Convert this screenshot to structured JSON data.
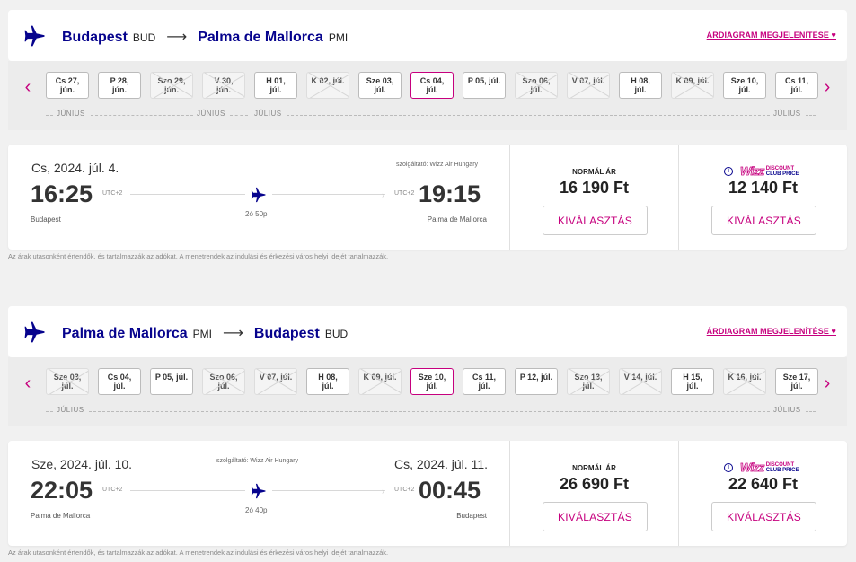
{
  "outbound": {
    "route": {
      "from_city": "Budapest",
      "from_code": "BUD",
      "to_city": "Palma de Mallorca",
      "to_code": "PMI",
      "diagram_link": "ÁRDIAGRAM MEGJELENÍTÉSE ♥"
    },
    "dates": [
      {
        "line1": "Cs 27,",
        "line2": "jún.",
        "state": "normal"
      },
      {
        "line1": "P 28,",
        "line2": "jún.",
        "state": "normal"
      },
      {
        "line1": "Szo 29,",
        "line2": "jún.",
        "state": "disabled"
      },
      {
        "line1": "V 30,",
        "line2": "jún.",
        "state": "disabled"
      },
      {
        "line1": "H 01,",
        "line2": "júl.",
        "state": "normal"
      },
      {
        "line1": "K 02, júl.",
        "line2": "",
        "state": "disabled"
      },
      {
        "line1": "Sze 03,",
        "line2": "júl.",
        "state": "normal"
      },
      {
        "line1": "Cs 04,",
        "line2": "júl.",
        "state": "selected"
      },
      {
        "line1": "P 05, júl.",
        "line2": "",
        "state": "normal"
      },
      {
        "line1": "Szo 06,",
        "line2": "júl.",
        "state": "disabled"
      },
      {
        "line1": "V 07, júl.",
        "line2": "",
        "state": "disabled"
      },
      {
        "line1": "H 08,",
        "line2": "júl.",
        "state": "normal"
      },
      {
        "line1": "K 09, júl.",
        "line2": "",
        "state": "disabled"
      },
      {
        "line1": "Sze 10,",
        "line2": "júl.",
        "state": "normal"
      },
      {
        "line1": "Cs 11,",
        "line2": "júl.",
        "state": "normal"
      }
    ],
    "months": {
      "m1": "JÚNIUS",
      "m2": "JÚNIUS",
      "m3": "JÚLIUS",
      "m4": "JÚLIUS"
    },
    "flight": {
      "date_left": "Cs, 2024. júl. 4.",
      "date_right": "",
      "operator": "szolgáltató: Wizz Air Hungary",
      "dep_time": "16:25",
      "dep_utc": "UTC+2",
      "arr_time": "19:15",
      "arr_utc": "UTC+2",
      "duration": "2ó 50p",
      "dep_place": "Budapest",
      "arr_place": "Palma de Mallorca",
      "normal_label": "NORMÁL ÁR",
      "normal_price": "16 190 Ft",
      "normal_button": "KIVÁLASZTÁS",
      "club_price": "12 140 Ft",
      "club_button": "KIVÁLASZTÁS"
    }
  },
  "inbound": {
    "route": {
      "from_city": "Palma de Mallorca",
      "from_code": "PMI",
      "to_city": "Budapest",
      "to_code": "BUD",
      "diagram_link": "ÁRDIAGRAM MEGJELENÍTÉSE ♥"
    },
    "dates": [
      {
        "line1": "Sze 03,",
        "line2": "júl.",
        "state": "disabled"
      },
      {
        "line1": "Cs 04,",
        "line2": "júl.",
        "state": "normal"
      },
      {
        "line1": "P 05, júl.",
        "line2": "",
        "state": "normal"
      },
      {
        "line1": "Szo 06,",
        "line2": "júl.",
        "state": "disabled"
      },
      {
        "line1": "V 07, júl.",
        "line2": "",
        "state": "disabled"
      },
      {
        "line1": "H 08,",
        "line2": "júl.",
        "state": "normal"
      },
      {
        "line1": "K 09, júl.",
        "line2": "",
        "state": "disabled"
      },
      {
        "line1": "Sze 10,",
        "line2": "júl.",
        "state": "selected"
      },
      {
        "line1": "Cs 11,",
        "line2": "júl.",
        "state": "normal"
      },
      {
        "line1": "P 12, júl.",
        "line2": "",
        "state": "normal"
      },
      {
        "line1": "Szo 13,",
        "line2": "júl.",
        "state": "disabled"
      },
      {
        "line1": "V 14, júl.",
        "line2": "",
        "state": "disabled"
      },
      {
        "line1": "H 15,",
        "line2": "júl.",
        "state": "normal"
      },
      {
        "line1": "K 16, júl.",
        "line2": "",
        "state": "disabled"
      },
      {
        "line1": "Sze 17,",
        "line2": "júl.",
        "state": "normal"
      }
    ],
    "months": {
      "m1": "JÚLIUS",
      "m2": "JÚLIUS"
    },
    "flight": {
      "date_left": "Sze, 2024. júl. 10.",
      "date_right": "Cs, 2024. júl. 11.",
      "operator": "szolgáltató: Wizz Air Hungary",
      "dep_time": "22:05",
      "dep_utc": "UTC+2",
      "arr_time": "00:45",
      "arr_utc": "UTC+2",
      "duration": "2ó 40p",
      "dep_place": "Palma de Mallorca",
      "arr_place": "Budapest",
      "normal_label": "NORMÁL ÁR",
      "normal_price": "26 690 Ft",
      "normal_button": "KIVÁLASZTÁS",
      "club_price": "22 640 Ft",
      "club_button": "KIVÁLASZTÁS"
    }
  },
  "club_badge": {
    "brand": "Wizz",
    "line1": "DISCOUNT",
    "line2": "CLUB PRICE",
    "info": "i"
  },
  "nav": {
    "prev": "‹",
    "next": "›",
    "arrow": "⟶"
  },
  "disclaimer": "Az árak utasonként értendők, és tartalmazzák az adókat. A menetrendek az indulási és érkezési város helyi idejét tartalmazzák.",
  "colors": {
    "brand_blue": "#06038d",
    "brand_magenta": "#c6007e"
  }
}
